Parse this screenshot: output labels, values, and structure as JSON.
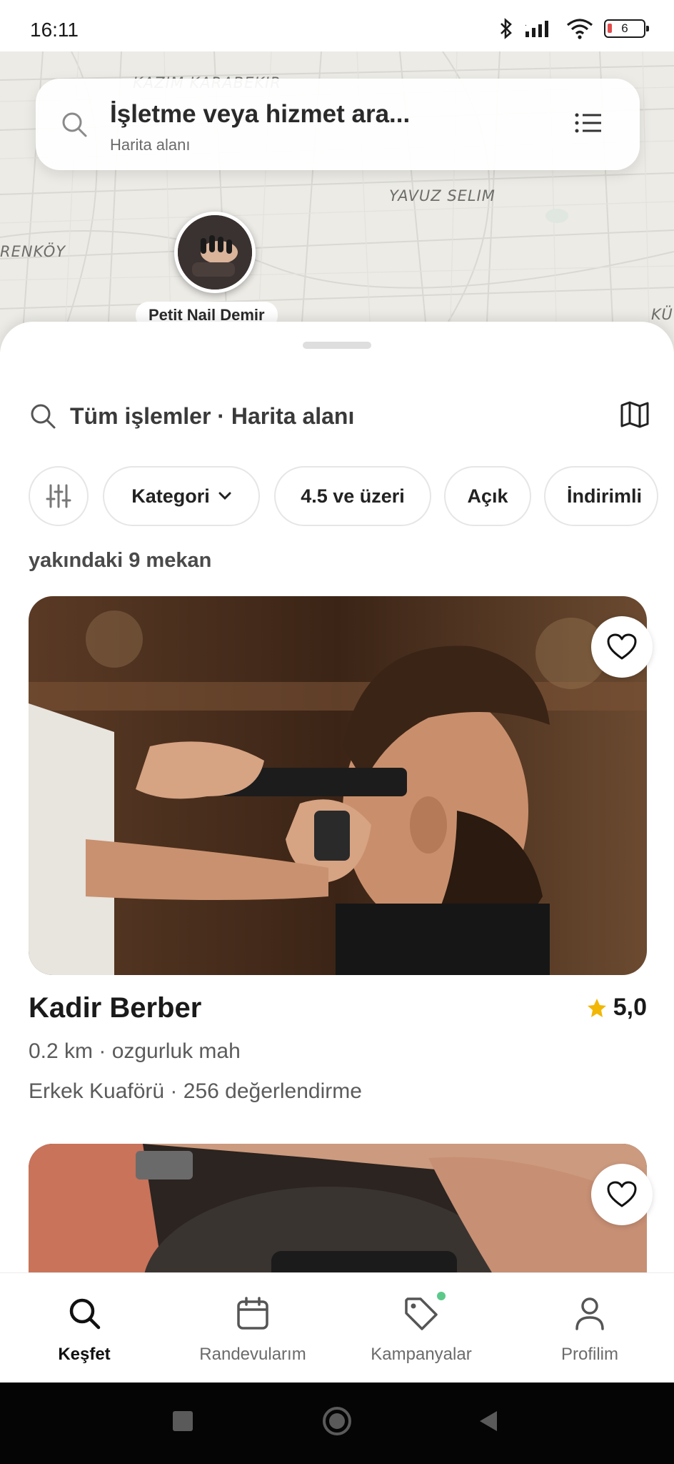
{
  "status_bar": {
    "time": "16:11",
    "battery": "6"
  },
  "map": {
    "labels": [
      "KAZIM KARABEKIR",
      "YAVUZ SELIM",
      "RENKÖY",
      "KÜ"
    ],
    "search_title": "İşletme veya hizmet ara...",
    "search_subtitle": "Harita alanı",
    "pin_label": "Petit Nail Demir"
  },
  "sheet": {
    "search_text": "Tüm işlemler · Harita alanı",
    "filters": [
      "Kategori",
      "4.5 ve üzeri",
      "Açık",
      "İndirimli"
    ],
    "results_count": "yakındaki 9 mekan"
  },
  "venues": [
    {
      "name": "Kadir Berber",
      "rating": "5,0",
      "distance_address": "0.2 km · ozgurluk mah",
      "category_reviews": "Erkek Kuaförü · 256 değerlendirme"
    }
  ],
  "tabs": [
    {
      "label": "Keşfet",
      "icon": "search-icon",
      "active": true
    },
    {
      "label": "Randevularım",
      "icon": "calendar-icon"
    },
    {
      "label": "Kampanyalar",
      "icon": "tag-icon"
    },
    {
      "label": "Profilim",
      "icon": "user-icon"
    }
  ],
  "colors": {
    "accent": "#111111",
    "star": "#f2b705",
    "badge": "#5cc98a",
    "map_bg": "#ecebe6"
  }
}
